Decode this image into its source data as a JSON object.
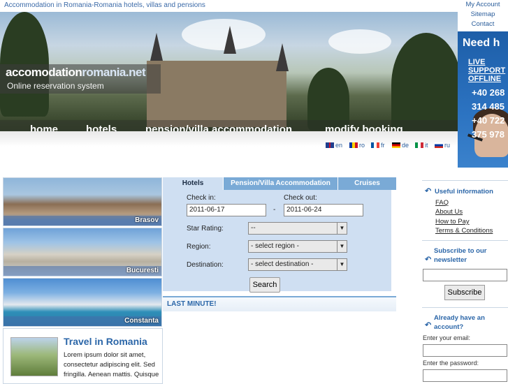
{
  "header": {
    "tagline": "Accommodation in Romania-Romania hotels, villas and pensions",
    "top_links": [
      "My Account",
      "Sitemap",
      "Contact"
    ]
  },
  "logo": {
    "name_a": "accomodation",
    "name_b": "romania.net",
    "subtitle": "Online reservation system"
  },
  "nav": {
    "home": "home",
    "hotels": "hotels",
    "pension": "pension/villa accommodation",
    "modify": "modify booking"
  },
  "languages": [
    {
      "code": "en",
      "colors": [
        "#1f3f8f",
        "#c8102e"
      ]
    },
    {
      "code": "ro",
      "colors": [
        "#0033a0",
        "#ffd200",
        "#ce1126"
      ]
    },
    {
      "code": "fr",
      "colors": [
        "#0055a4",
        "#ffffff",
        "#ef4135"
      ]
    },
    {
      "code": "de",
      "colors": [
        "#000000",
        "#dd0000",
        "#ffce00"
      ]
    },
    {
      "code": "it",
      "colors": [
        "#009246",
        "#ffffff",
        "#ce2b37"
      ]
    },
    {
      "code": "ru",
      "colors": [
        "#ffffff",
        "#0039a6",
        "#d52b1e"
      ]
    }
  ],
  "support": {
    "need": "Need h",
    "online": "LIVE SUPPORT OFFLINE",
    "phones": [
      "+40 268",
      "314 485",
      "+40 722",
      "375 978"
    ]
  },
  "cities": [
    "Brasov",
    "Bucuresti",
    "Constanta"
  ],
  "travel": {
    "title": "Travel in Romania",
    "body": "Lorem ipsum dolor sit amet, consectetur adipiscing elit. Sed fringilla. Aenean mattis. Quisque"
  },
  "search": {
    "tabs": [
      "Hotels",
      "Pension/Villa Accommodation",
      "Cruises"
    ],
    "checkin_label": "Check in:",
    "checkout_label": "Check out:",
    "checkin_value": "2011-06-17",
    "checkout_value": "2011-06-24",
    "date_separator": "-",
    "star_label": "Star Rating:",
    "star_value": "--",
    "region_label": "Region:",
    "region_value": "- select region -",
    "destination_label": "Destination:",
    "destination_value": "- select destination -",
    "search_button": "Search"
  },
  "last_minute": "LAST MINUTE!",
  "sidebar": {
    "useful_title": "Useful information",
    "useful_links": [
      "FAQ",
      "About Us",
      "How to Pay",
      "Terms & Conditions"
    ],
    "newsletter_title": "Subscribe to our newsletter",
    "subscribe_button": "Subscribe",
    "account_title": "Already have an account?",
    "email_label": "Enter your email:",
    "password_label": "Enter the password:"
  }
}
